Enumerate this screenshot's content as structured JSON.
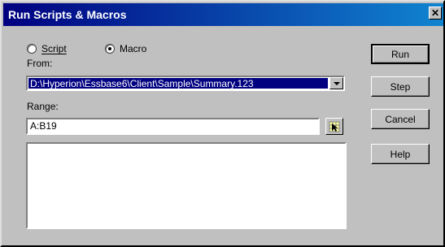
{
  "window": {
    "title": "Run Scripts & Macros",
    "close_label": "✕"
  },
  "source_type": {
    "script_label": "Script",
    "macro_label": "Macro",
    "selected": "macro"
  },
  "from": {
    "label": "From:",
    "value": "D:\\Hyperion\\Essbase6\\Client\\Sample\\Summary.123"
  },
  "range": {
    "label": "Range:",
    "value": "A:B19"
  },
  "buttons": {
    "run": "Run",
    "step": "Step",
    "cancel": "Cancel",
    "help": "Help"
  },
  "icons": {
    "close": "close-icon",
    "dropdown": "chevron-down-icon",
    "range_picker": "range-picker-icon"
  }
}
